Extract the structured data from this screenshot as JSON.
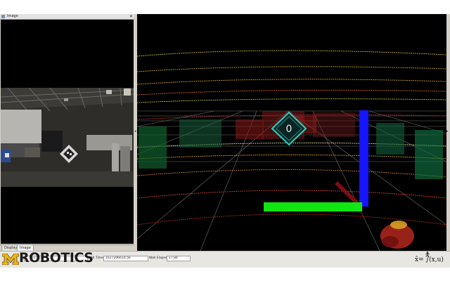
{
  "left_panel": {
    "title": "Image",
    "close_glyph": "✕",
    "tabs": [
      "Displays",
      "Image"
    ]
  },
  "view3d": {
    "tag_label": "0"
  },
  "time_panel": {
    "ros_time_value": "...1617.73",
    "wall_time_label": "Wall Time:",
    "wall_time_value": "1617206610.56",
    "wall_elapsed_label": "Wall Elapsed:",
    "wall_elapsed_value": "17.84"
  },
  "branding": {
    "logo_text": "ROBOTICS",
    "formula_text": "x̂=  ∫(x,u)",
    "figure_glyph": "🯅"
  },
  "colors": {
    "maize": "#f2b705",
    "axis_green": "#12e612",
    "axis_blue": "#1515ff",
    "axis_red": "#8a1010",
    "tag_cyan": "#29d6c6"
  }
}
